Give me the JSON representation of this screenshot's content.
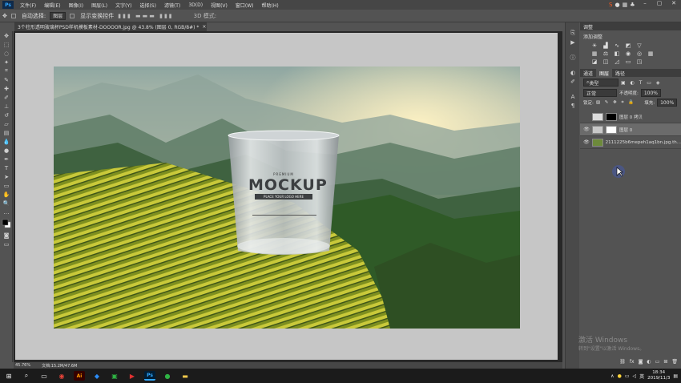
{
  "app": {
    "logo": "Ps"
  },
  "menu": [
    "文件(F)",
    "编辑(E)",
    "图像(I)",
    "图层(L)",
    "文字(Y)",
    "选择(S)",
    "滤镜(T)",
    "3D(D)",
    "视图(V)",
    "窗口(W)",
    "帮助(H)"
  ],
  "options": {
    "auto_select": "自动选择:",
    "auto_select_value": "图层",
    "show_transform": "显示变换控件"
  },
  "document_tab": {
    "title": "3个柱形透明玻璃杯PSD样机模板素材-DOOOOR.jpg @ 43.8% (图层 0, RGB/8#) *",
    "close": "×"
  },
  "status": {
    "zoom": "45.76%",
    "doc_size": "文档:15.2M/47.6M"
  },
  "panels": {
    "adjust_title": "调整",
    "adjust_subtitle": "添加调整",
    "tabs": [
      "通道",
      "图层",
      "路径"
    ],
    "active_tab": "图层",
    "kind_filter": "类型",
    "blend_mode": "正常",
    "opacity_label": "不透明度:",
    "opacity_value": "100%",
    "lock_label": "锁定:",
    "fill_label": "填充:",
    "fill_value": "100%",
    "layers": [
      {
        "name": "图层 0 拷贝",
        "visible": false,
        "selected": false
      },
      {
        "name": "图层 0",
        "visible": true,
        "selected": true
      },
      {
        "name": "2111225b6mepeh1aq1bn.jpg.th...",
        "visible": true,
        "selected": false
      }
    ]
  },
  "watermark": {
    "line1": "激活 Windows",
    "line2": "转到\"设置\"以激活 Windows。"
  },
  "mockup": {
    "premium": "PREMIUM",
    "title": "MOCKUP",
    "subtitle": "PLACE YOUR LOGO HERE"
  },
  "taskbar": {
    "apps": [
      "Ai",
      "Ps"
    ],
    "ime": "英",
    "time": "18:34",
    "date": "2019/11/3"
  },
  "colors": {
    "ps_blue": "#31a8ff",
    "cursor": "#3b5bdb"
  }
}
